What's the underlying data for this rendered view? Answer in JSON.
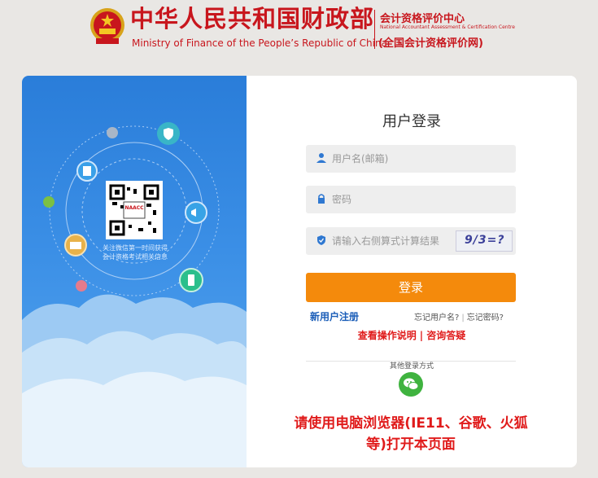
{
  "header": {
    "title_cn": "中华人民共和国财政部",
    "title_en": "Ministry of Finance of the People’s Republic of China",
    "center_cn": "会计资格评价中心",
    "center_en": "National Accountant Assessment & Certification Centre",
    "center_site": "(全国会计资格评价网)"
  },
  "left_panel": {
    "qr_label": "NAACC",
    "qr_caption_line1": "关注微信第一时间获得",
    "qr_caption_line2": "会计资格考试相关信息"
  },
  "login": {
    "title": "用户登录",
    "username_placeholder": "用户名(邮箱)",
    "password_placeholder": "密码",
    "captcha_placeholder": "请输入右侧算式计算结果",
    "captcha_text": "9/3=?",
    "submit_label": "登录",
    "register_link": "新用户注册",
    "forgot_username": "忘记用户名?",
    "forgot_password": "忘记密码?",
    "help_instructions": "查看操作说明",
    "help_faq": "咨询答疑",
    "other_login_label": "其他登录方式",
    "notice": "请使用电脑浏览器(IE11、谷歌、火狐等)打开本页面"
  },
  "colors": {
    "brand_red": "#c8161d",
    "login_orange": "#f48a0c",
    "link_blue": "#1a5db8",
    "wechat_green": "#3fb33f"
  },
  "icons": [
    "national-emblem-icon",
    "user-icon",
    "lock-icon",
    "shield-icon",
    "wechat-icon"
  ]
}
